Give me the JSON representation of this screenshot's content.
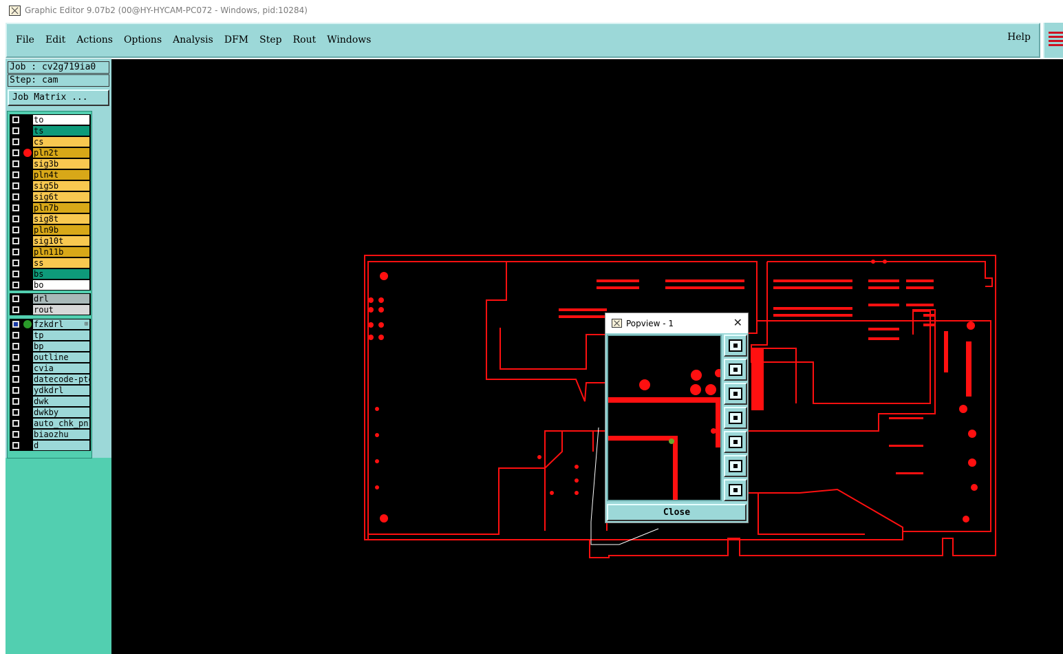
{
  "window": {
    "title": "Graphic Editor 9.07b2 (00@HY-HYCAM-PC072 - Windows, pid:10284)"
  },
  "menubar": {
    "items": [
      "File",
      "Edit",
      "Actions",
      "Options",
      "Analysis",
      "DFM",
      "Step",
      "Rout",
      "Windows"
    ],
    "help": "Help"
  },
  "job": {
    "job_label": "Job : cv2g719ia0",
    "step_label": "Step: cam",
    "matrix_button": "Job Matrix ..."
  },
  "layers": {
    "board": [
      {
        "name": "to",
        "color": "#ffffff"
      },
      {
        "name": "ts",
        "color": "#0e9a7a"
      },
      {
        "name": "cs",
        "color": "#f8c850"
      },
      {
        "name": "pln2t",
        "color": "#d8a818",
        "dot": "#ff1010"
      },
      {
        "name": "sig3b",
        "color": "#f8c850"
      },
      {
        "name": "pln4t",
        "color": "#d8a818"
      },
      {
        "name": "sig5b",
        "color": "#f8c850"
      },
      {
        "name": "sig6t",
        "color": "#f8c850"
      },
      {
        "name": "pln7b",
        "color": "#d8a818"
      },
      {
        "name": "sig8t",
        "color": "#f8c850"
      },
      {
        "name": "pln9b",
        "color": "#d8a818"
      },
      {
        "name": "sig10t",
        "color": "#f8c850"
      },
      {
        "name": "pln11b",
        "color": "#d8a818"
      },
      {
        "name": "ss",
        "color": "#f8c850"
      },
      {
        "name": "bs",
        "color": "#0e9a7a"
      },
      {
        "name": "bo",
        "color": "#ffffff"
      }
    ],
    "drill": [
      {
        "name": "drl",
        "color": "#a8b8b8"
      },
      {
        "name": "rout",
        "color": "#d8d8d8"
      }
    ],
    "misc": [
      {
        "name": "fzkdrl",
        "color": "#9cd8d8",
        "dot": "#2a9a2a",
        "checked": true,
        "extra": "⊞"
      },
      {
        "name": "tp",
        "color": "#9cd8d8"
      },
      {
        "name": "bp",
        "color": "#9cd8d8"
      },
      {
        "name": "outline",
        "color": "#9cd8d8"
      },
      {
        "name": "cvia",
        "color": "#9cd8d8"
      },
      {
        "name": "datecode-pte",
        "color": "#9cd8d8"
      },
      {
        "name": "ydkdrl",
        "color": "#9cd8d8"
      },
      {
        "name": "dwk",
        "color": "#9cd8d8"
      },
      {
        "name": "dwkby",
        "color": "#9cd8d8"
      },
      {
        "name": "auto_chk_pnl",
        "color": "#9cd8d8"
      },
      {
        "name": "biaozhu",
        "color": "#9cd8d8"
      },
      {
        "name": "d",
        "color": "#9cd8d8"
      }
    ]
  },
  "popview": {
    "title": "Popview - 1",
    "close_label": "Close",
    "tools": [
      "zoom-home-icon",
      "pan-up-icon",
      "pan-down-icon",
      "pan-left-icon",
      "pan-right-icon",
      "zoom-in-icon",
      "zoom-out-icon"
    ]
  },
  "colors": {
    "panel": "#9cd8d8",
    "feature": "#ff1010",
    "canvas": "#000000"
  }
}
